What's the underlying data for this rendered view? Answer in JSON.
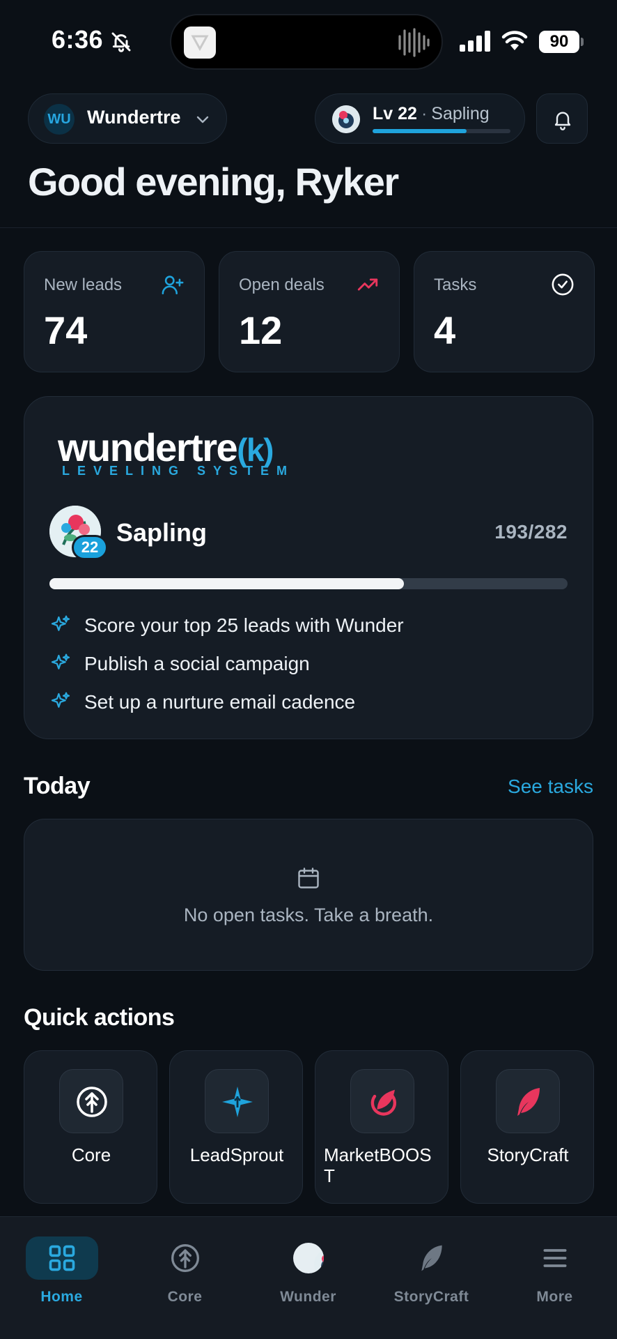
{
  "status_bar": {
    "time": "6:36",
    "battery": "90"
  },
  "header": {
    "workspace_initials": "WU",
    "workspace_name": "Wundertre",
    "level_label": "Lv 22",
    "level_separator": "·",
    "level_rank": "Sapling",
    "level_progress_fraction": 0.68,
    "greeting": "Good evening, Ryker"
  },
  "stats": [
    {
      "label": "New leads",
      "value": "74",
      "icon": "add-user-icon",
      "color": "#1fa3dc"
    },
    {
      "label": "Open deals",
      "value": "12",
      "icon": "trending-up-icon",
      "color": "#e8365d"
    },
    {
      "label": "Tasks",
      "value": "4",
      "icon": "check-circle-icon",
      "color": "#ffffff"
    }
  ],
  "leveling": {
    "logo_text": "wundertre",
    "logo_k": "(k)",
    "logo_subtitle": "LEVELING SYSTEM",
    "badge_level": "22",
    "rank": "Sapling",
    "xp_text": "193/282",
    "xp_current": 193,
    "xp_total": 282,
    "quests": [
      "Score your top 25 leads with Wunder",
      "Publish a social campaign",
      "Set up a nurture email cadence"
    ],
    "accent_color": "#2aa9df"
  },
  "today": {
    "title": "Today",
    "link": "See tasks",
    "empty_message": "No open tasks. Take a breath."
  },
  "quick_actions": {
    "title": "Quick actions",
    "items": [
      {
        "label": "Core",
        "icon": "tree-arrow-icon"
      },
      {
        "label": "LeadSprout",
        "icon": "sparkle-star-icon"
      },
      {
        "label": "MarketBOOST",
        "icon": "leaf-swirl-icon"
      },
      {
        "label": "StoryCraft",
        "icon": "feather-icon"
      }
    ]
  },
  "bottom_nav": {
    "items": [
      {
        "label": "Home",
        "icon": "grid-icon",
        "active": true
      },
      {
        "label": "Core",
        "icon": "tree-arrow-icon",
        "active": false
      },
      {
        "label": "Wunder",
        "icon": "wunder-avatar-icon",
        "active": false
      },
      {
        "label": "StoryCraft",
        "icon": "feather-icon",
        "active": false
      },
      {
        "label": "More",
        "icon": "menu-icon",
        "active": false
      }
    ],
    "active_color": "#2aa9df"
  }
}
